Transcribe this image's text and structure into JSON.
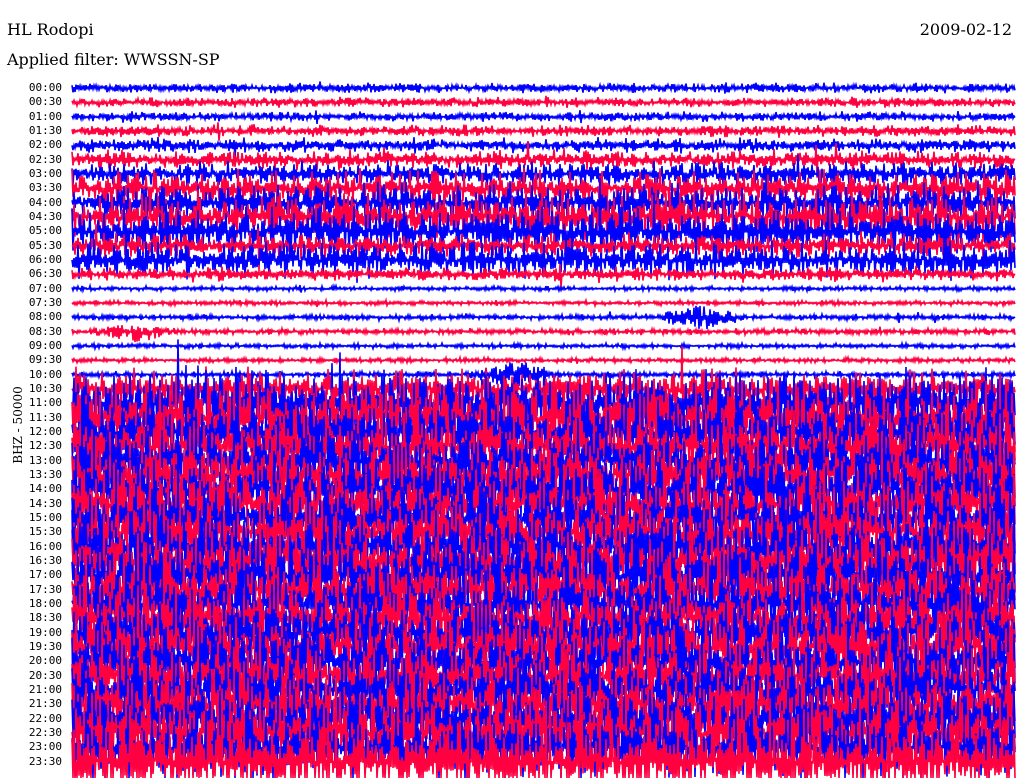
{
  "header": {
    "station": "HL Rodopi",
    "date": "2009-02-12",
    "filter": "Applied filter: WWSSN-SP"
  },
  "chart_data": {
    "type": "line",
    "title": "HL Rodopi",
    "ylabel": "BHZ - 50000",
    "colors": [
      "#0000ff",
      "#ff0040"
    ],
    "minutes_per_line": 30,
    "row_labels": [
      "00:00",
      "00:30",
      "01:00",
      "01:30",
      "02:00",
      "02:30",
      "03:00",
      "03:30",
      "04:00",
      "04:30",
      "05:00",
      "05:30",
      "06:00",
      "06:30",
      "07:00",
      "07:30",
      "08:00",
      "08:30",
      "09:00",
      "09:30",
      "10:00",
      "10:30",
      "11:00",
      "11:30",
      "12:00",
      "12:30",
      "13:00",
      "13:30",
      "14:00",
      "14:30",
      "15:00",
      "15:30",
      "16:00",
      "16:30",
      "17:00",
      "17:30",
      "18:00",
      "18:30",
      "19:00",
      "19:30",
      "20:00",
      "20:30",
      "21:00",
      "21:30",
      "22:00",
      "22:30",
      "23:00",
      "23:30"
    ],
    "relative_amplitude": [
      0.4,
      0.4,
      0.4,
      0.5,
      0.6,
      0.8,
      1.0,
      1.5,
      1.6,
      2.0,
      2.0,
      1.0,
      1.5,
      0.6,
      0.2,
      0.2,
      0.25,
      0.25,
      0.2,
      0.2,
      0.25,
      1.6,
      3,
      3,
      3,
      3,
      3,
      3,
      3,
      3,
      3,
      3,
      3,
      3,
      3,
      3,
      3,
      3,
      3,
      3,
      3,
      3,
      3,
      3,
      3,
      3,
      3,
      3.5
    ],
    "events": [
      {
        "row": 16,
        "minute": 20,
        "amplitude": 0.8
      },
      {
        "row": 17,
        "minute": 2,
        "amplitude": 0.6
      },
      {
        "row": 20,
        "minute": 14,
        "amplitude": 0.9
      }
    ]
  }
}
